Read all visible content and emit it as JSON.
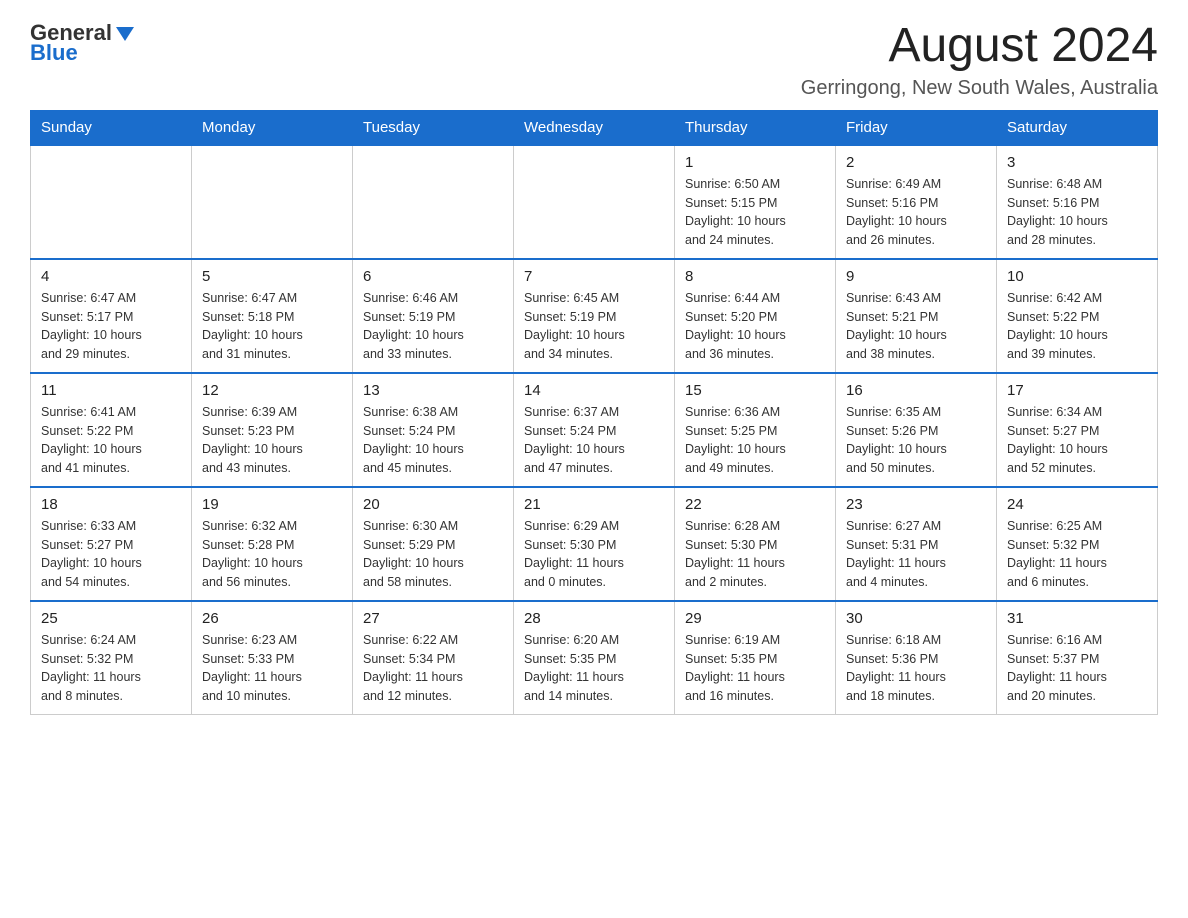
{
  "header": {
    "logo": {
      "general": "General",
      "blue": "Blue"
    },
    "title": "August 2024",
    "subtitle": "Gerringong, New South Wales, Australia"
  },
  "days_of_week": [
    "Sunday",
    "Monday",
    "Tuesday",
    "Wednesday",
    "Thursday",
    "Friday",
    "Saturday"
  ],
  "weeks": [
    [
      {
        "day": "",
        "info": ""
      },
      {
        "day": "",
        "info": ""
      },
      {
        "day": "",
        "info": ""
      },
      {
        "day": "",
        "info": ""
      },
      {
        "day": "1",
        "info": "Sunrise: 6:50 AM\nSunset: 5:15 PM\nDaylight: 10 hours\nand 24 minutes."
      },
      {
        "day": "2",
        "info": "Sunrise: 6:49 AM\nSunset: 5:16 PM\nDaylight: 10 hours\nand 26 minutes."
      },
      {
        "day": "3",
        "info": "Sunrise: 6:48 AM\nSunset: 5:16 PM\nDaylight: 10 hours\nand 28 minutes."
      }
    ],
    [
      {
        "day": "4",
        "info": "Sunrise: 6:47 AM\nSunset: 5:17 PM\nDaylight: 10 hours\nand 29 minutes."
      },
      {
        "day": "5",
        "info": "Sunrise: 6:47 AM\nSunset: 5:18 PM\nDaylight: 10 hours\nand 31 minutes."
      },
      {
        "day": "6",
        "info": "Sunrise: 6:46 AM\nSunset: 5:19 PM\nDaylight: 10 hours\nand 33 minutes."
      },
      {
        "day": "7",
        "info": "Sunrise: 6:45 AM\nSunset: 5:19 PM\nDaylight: 10 hours\nand 34 minutes."
      },
      {
        "day": "8",
        "info": "Sunrise: 6:44 AM\nSunset: 5:20 PM\nDaylight: 10 hours\nand 36 minutes."
      },
      {
        "day": "9",
        "info": "Sunrise: 6:43 AM\nSunset: 5:21 PM\nDaylight: 10 hours\nand 38 minutes."
      },
      {
        "day": "10",
        "info": "Sunrise: 6:42 AM\nSunset: 5:22 PM\nDaylight: 10 hours\nand 39 minutes."
      }
    ],
    [
      {
        "day": "11",
        "info": "Sunrise: 6:41 AM\nSunset: 5:22 PM\nDaylight: 10 hours\nand 41 minutes."
      },
      {
        "day": "12",
        "info": "Sunrise: 6:39 AM\nSunset: 5:23 PM\nDaylight: 10 hours\nand 43 minutes."
      },
      {
        "day": "13",
        "info": "Sunrise: 6:38 AM\nSunset: 5:24 PM\nDaylight: 10 hours\nand 45 minutes."
      },
      {
        "day": "14",
        "info": "Sunrise: 6:37 AM\nSunset: 5:24 PM\nDaylight: 10 hours\nand 47 minutes."
      },
      {
        "day": "15",
        "info": "Sunrise: 6:36 AM\nSunset: 5:25 PM\nDaylight: 10 hours\nand 49 minutes."
      },
      {
        "day": "16",
        "info": "Sunrise: 6:35 AM\nSunset: 5:26 PM\nDaylight: 10 hours\nand 50 minutes."
      },
      {
        "day": "17",
        "info": "Sunrise: 6:34 AM\nSunset: 5:27 PM\nDaylight: 10 hours\nand 52 minutes."
      }
    ],
    [
      {
        "day": "18",
        "info": "Sunrise: 6:33 AM\nSunset: 5:27 PM\nDaylight: 10 hours\nand 54 minutes."
      },
      {
        "day": "19",
        "info": "Sunrise: 6:32 AM\nSunset: 5:28 PM\nDaylight: 10 hours\nand 56 minutes."
      },
      {
        "day": "20",
        "info": "Sunrise: 6:30 AM\nSunset: 5:29 PM\nDaylight: 10 hours\nand 58 minutes."
      },
      {
        "day": "21",
        "info": "Sunrise: 6:29 AM\nSunset: 5:30 PM\nDaylight: 11 hours\nand 0 minutes."
      },
      {
        "day": "22",
        "info": "Sunrise: 6:28 AM\nSunset: 5:30 PM\nDaylight: 11 hours\nand 2 minutes."
      },
      {
        "day": "23",
        "info": "Sunrise: 6:27 AM\nSunset: 5:31 PM\nDaylight: 11 hours\nand 4 minutes."
      },
      {
        "day": "24",
        "info": "Sunrise: 6:25 AM\nSunset: 5:32 PM\nDaylight: 11 hours\nand 6 minutes."
      }
    ],
    [
      {
        "day": "25",
        "info": "Sunrise: 6:24 AM\nSunset: 5:32 PM\nDaylight: 11 hours\nand 8 minutes."
      },
      {
        "day": "26",
        "info": "Sunrise: 6:23 AM\nSunset: 5:33 PM\nDaylight: 11 hours\nand 10 minutes."
      },
      {
        "day": "27",
        "info": "Sunrise: 6:22 AM\nSunset: 5:34 PM\nDaylight: 11 hours\nand 12 minutes."
      },
      {
        "day": "28",
        "info": "Sunrise: 6:20 AM\nSunset: 5:35 PM\nDaylight: 11 hours\nand 14 minutes."
      },
      {
        "day": "29",
        "info": "Sunrise: 6:19 AM\nSunset: 5:35 PM\nDaylight: 11 hours\nand 16 minutes."
      },
      {
        "day": "30",
        "info": "Sunrise: 6:18 AM\nSunset: 5:36 PM\nDaylight: 11 hours\nand 18 minutes."
      },
      {
        "day": "31",
        "info": "Sunrise: 6:16 AM\nSunset: 5:37 PM\nDaylight: 11 hours\nand 20 minutes."
      }
    ]
  ]
}
